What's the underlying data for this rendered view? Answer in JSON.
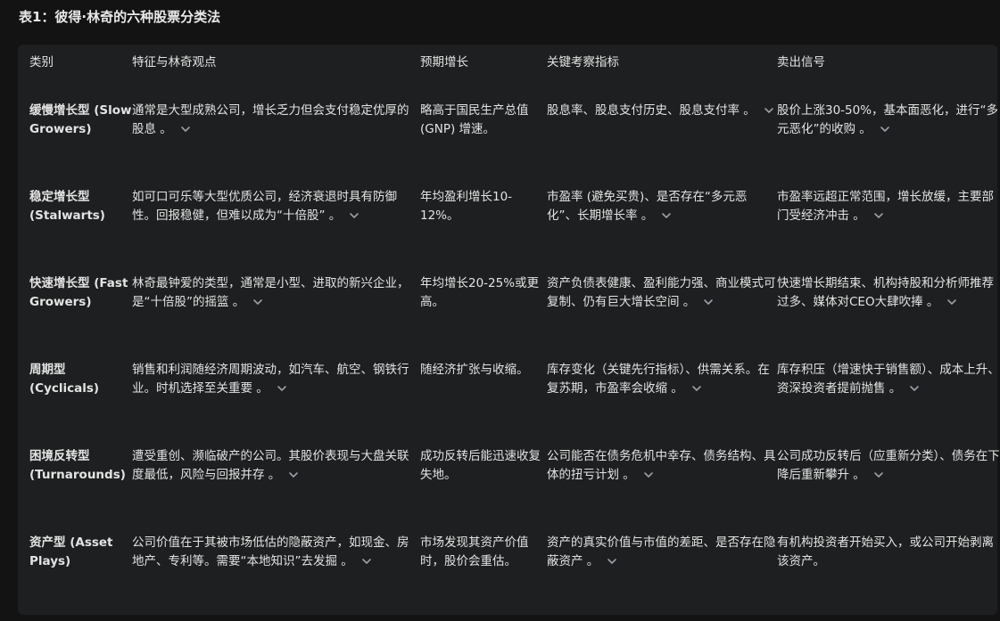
{
  "title": "表1：彼得·林奇的六种股票分类法",
  "headers": [
    "类别",
    "特征与林奇观点",
    "预期增长",
    "关键考察指标",
    "卖出信号"
  ],
  "rows": [
    {
      "category": "缓慢增长型 (Slow Growers)",
      "features": "通常是大型成熟公司，增长乏力但会支付稳定优厚的股息 。",
      "growth": "略高于国民生产总值 (GNP) 增速。",
      "metrics": "股息率、股息支付历史、股息支付率 。",
      "sell": "股价上涨30-50%，基本面恶化，进行“多元恶化”的收购 。"
    },
    {
      "category": "稳定增长型 (Stalwarts)",
      "features": "如可口可乐等大型优质公司，经济衰退时具有防御性。回报稳健，但难以成为“十倍股” 。",
      "growth": "年均盈利增长10-12%。",
      "metrics": "市盈率 (避免买贵)、是否存在“多元恶化”、长期增长率 。",
      "sell": "市盈率远超正常范围，增长放缓，主要部门受经济冲击 。"
    },
    {
      "category": "快速增长型 (Fast Growers)",
      "features": "林奇最钟爱的类型，通常是小型、进取的新兴企业，是“十倍股”的摇篮 。",
      "growth": "年均增长20-25%或更高。",
      "metrics": "资产负债表健康、盈利能力强、商业模式可复制、仍有巨大增长空间 。",
      "sell": "快速增长期结束、机构持股和分析师推荐过多、媒体对CEO大肆吹捧 。"
    },
    {
      "category": "周期型 (Cyclicals)",
      "features": "销售和利润随经济周期波动，如汽车、航空、钢铁行业。时机选择至关重要 。",
      "growth": "随经济扩张与收缩。",
      "metrics": "库存变化（关键先行指标）、供需关系。在复苏期，市盈率会收缩 。",
      "sell": "库存积压（增速快于销售额）、成本上升、资深投资者提前抛售 。"
    },
    {
      "category": "困境反转型 (Turnarounds)",
      "features": "遭受重创、濒临破产的公司。其股价表现与大盘关联度最低，风险与回报并存 。",
      "growth": "成功反转后能迅速收复失地。",
      "metrics": "公司能否在债务危机中幸存、债务结构、具体的扭亏计划 。",
      "sell": "公司成功反转后（应重新分类）、债务在下降后重新攀升 。"
    },
    {
      "category": "资产型 (Asset Plays)",
      "features": "公司价值在于其被市场低估的隐蔽资产，如现金、房地产、专利等。需要“本地知识”去发掘 。",
      "growth": "市场发现其资产价值时，股价会重估。",
      "metrics": "资产的真实价值与市值的差距、是否存在隐蔽资产 。",
      "sell": "有机构投资者开始买入，或公司开始剥离该资产。"
    }
  ],
  "chevrons": {
    "0": [
      "features",
      "metrics",
      "sell"
    ],
    "1": [
      "features",
      "metrics",
      "sell"
    ],
    "2": [
      "features",
      "metrics",
      "sell"
    ],
    "3": [
      "features",
      "metrics",
      "sell"
    ],
    "4": [
      "features",
      "metrics",
      "sell"
    ],
    "5": [
      "features",
      "metrics"
    ]
  },
  "icon": "chevron-down-icon"
}
